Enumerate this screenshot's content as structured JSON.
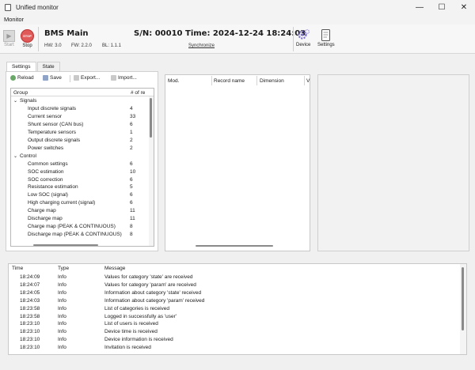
{
  "window": {
    "title": "Unified monitor",
    "controls": [
      "—",
      "☐",
      "✕"
    ]
  },
  "menu": {
    "items": [
      "Monitor"
    ]
  },
  "toolbar": {
    "start_label": "Start",
    "stop_label": "Stop",
    "stop_icon_text": "STOP",
    "device_name": "BMS Main",
    "hw": "HW: 3.0",
    "fw": "FW: 2.2.0",
    "bl": "BL: 1.1.1",
    "serial": "S/N: 00010",
    "time": "Time: 2024-12-24 18:24:03",
    "sync_label": "Synchronize",
    "device_label": "Device",
    "settings_label": "Settings"
  },
  "tabs": [
    {
      "label": "Settings",
      "active": true
    },
    {
      "label": "State",
      "active": false
    }
  ],
  "settings_toolbar": {
    "reload": "Reload",
    "save": "Save",
    "export": "Export...",
    "import": "Import..."
  },
  "group_grid": {
    "columns": [
      "Group",
      "# of re"
    ],
    "rows": [
      {
        "name": "Signals",
        "value": "",
        "level": 0,
        "expanded": true
      },
      {
        "name": "Input discrete signals",
        "value": "4",
        "level": 1
      },
      {
        "name": "Current sensor",
        "value": "33",
        "level": 1
      },
      {
        "name": "Shunt sensor (CAN bus)",
        "value": "6",
        "level": 1
      },
      {
        "name": "Temperature sensors",
        "value": "1",
        "level": 1
      },
      {
        "name": "Output discrete signals",
        "value": "2",
        "level": 1
      },
      {
        "name": "Power switches",
        "value": "2",
        "level": 1
      },
      {
        "name": "Control",
        "value": "",
        "level": 0,
        "expanded": true
      },
      {
        "name": "Common settings",
        "value": "6",
        "level": 1
      },
      {
        "name": "SOC estimation",
        "value": "10",
        "level": 1
      },
      {
        "name": "SOC correction",
        "value": "6",
        "level": 1
      },
      {
        "name": "Resistance estimation",
        "value": "5",
        "level": 1
      },
      {
        "name": "Low SOC (signal)",
        "value": "6",
        "level": 1
      },
      {
        "name": "High charging current (signal)",
        "value": "6",
        "level": 1
      },
      {
        "name": "Charge map",
        "value": "11",
        "level": 1
      },
      {
        "name": "Discharge map",
        "value": "11",
        "level": 1
      },
      {
        "name": "Charge map (PEAK & CONTINUOUS)",
        "value": "8",
        "level": 1
      },
      {
        "name": "Discharge map (PEAK & CONTINUOUS)",
        "value": "8",
        "level": 1
      }
    ]
  },
  "records_grid": {
    "columns": [
      "Mod.",
      "Record name",
      "Dimension",
      "V"
    ]
  },
  "log": {
    "columns": [
      "Time",
      "Type",
      "Message"
    ],
    "rows": [
      {
        "time": "18:24:09",
        "type": "Info",
        "message": "Values for category 'state' are received"
      },
      {
        "time": "18:24:07",
        "type": "Info",
        "message": "Values for category 'param' are received"
      },
      {
        "time": "18:24:05",
        "type": "Info",
        "message": "Information about category 'state' received"
      },
      {
        "time": "18:24:03",
        "type": "Info",
        "message": "Information about category 'param' received"
      },
      {
        "time": "18:23:58",
        "type": "Info",
        "message": "List of categories is received"
      },
      {
        "time": "18:23:58",
        "type": "Info",
        "message": "Logged in successfully as 'user'"
      },
      {
        "time": "18:23:10",
        "type": "Info",
        "message": "List of users is received"
      },
      {
        "time": "18:23:10",
        "type": "Info",
        "message": "Device time is received"
      },
      {
        "time": "18:23:10",
        "type": "Info",
        "message": "Device information is received"
      },
      {
        "time": "18:23:10",
        "type": "Info",
        "message": "Invitation is received"
      }
    ]
  },
  "colors": {
    "stop_button": "#e05a5a",
    "gear_icon": "#7a6fc4",
    "accent": "#3a66c0"
  }
}
